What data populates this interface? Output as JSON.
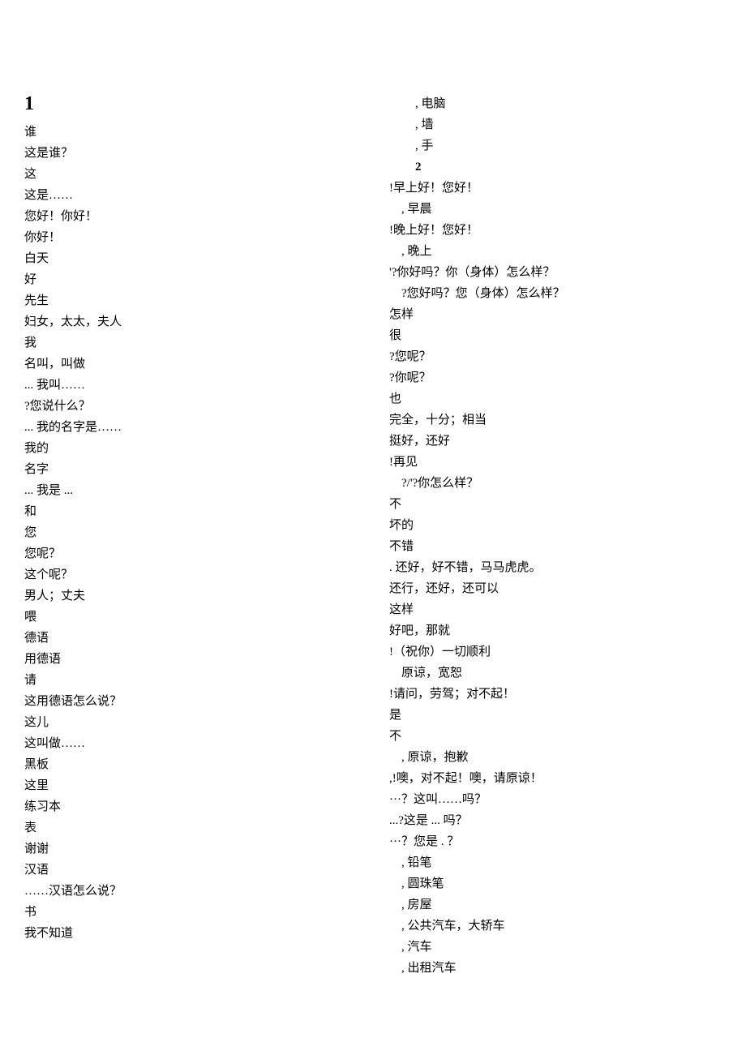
{
  "left": {
    "heading": "1",
    "lines": [
      "谁",
      "这是谁？",
      "这",
      "这是……",
      "您好！你好！",
      "你好！",
      "白天",
      "好",
      "先生",
      "妇女，太太，夫人",
      "我",
      "名叫，叫做",
      "... 我叫……",
      "?您说什么？",
      "... 我的名字是……",
      "我的",
      "名字",
      "... 我是 ...",
      "和",
      "您",
      "您呢？",
      "这个呢？",
      "男人；丈夫",
      "喂",
      "德语",
      "用德语",
      "请",
      "这用德语怎么说？",
      "这儿",
      "这叫做……",
      "黑板",
      "这里",
      "练习本",
      "表",
      "谢谢",
      "汉语",
      "……汉语怎么说？",
      "书",
      "我不知道"
    ]
  },
  "right": {
    "top_indented": [
      ", 电脑",
      ", 墙",
      ", 手"
    ],
    "heading": "2",
    "lines": [
      "!早上好！您好！",
      "    , 早晨",
      "!晚上好！您好！",
      "    , 晚上",
      "'?你好吗？你（身体）怎么样？",
      "    ?您好吗？您（身体）怎么样？",
      "怎样",
      "很",
      "?您呢？",
      "?你呢？",
      "也",
      "完全，十分；相当",
      "挺好，还好",
      "!再见",
      "    ?/'?你怎么样？",
      "不",
      "坏的",
      "不错",
      ". 还好，好不错，马马虎虎。",
      "还行，还好，还可以",
      "这样",
      "好吧，那就",
      "!（祝你）一切顺利",
      "    原谅，宽恕",
      "!请问，劳驾；对不起！",
      "是",
      "不",
      "    , 原谅，抱歉",
      ",!噢，对不起！噢，请原谅！",
      "···？这叫……吗？",
      "...?这是 ... 吗？",
      "···？您是 . ？",
      "    , 铅笔",
      "    , 圆珠笔",
      "    , 房屋",
      "    , 公共汽车，大轿车",
      "    , 汽车",
      "    , 出租汽车"
    ]
  }
}
